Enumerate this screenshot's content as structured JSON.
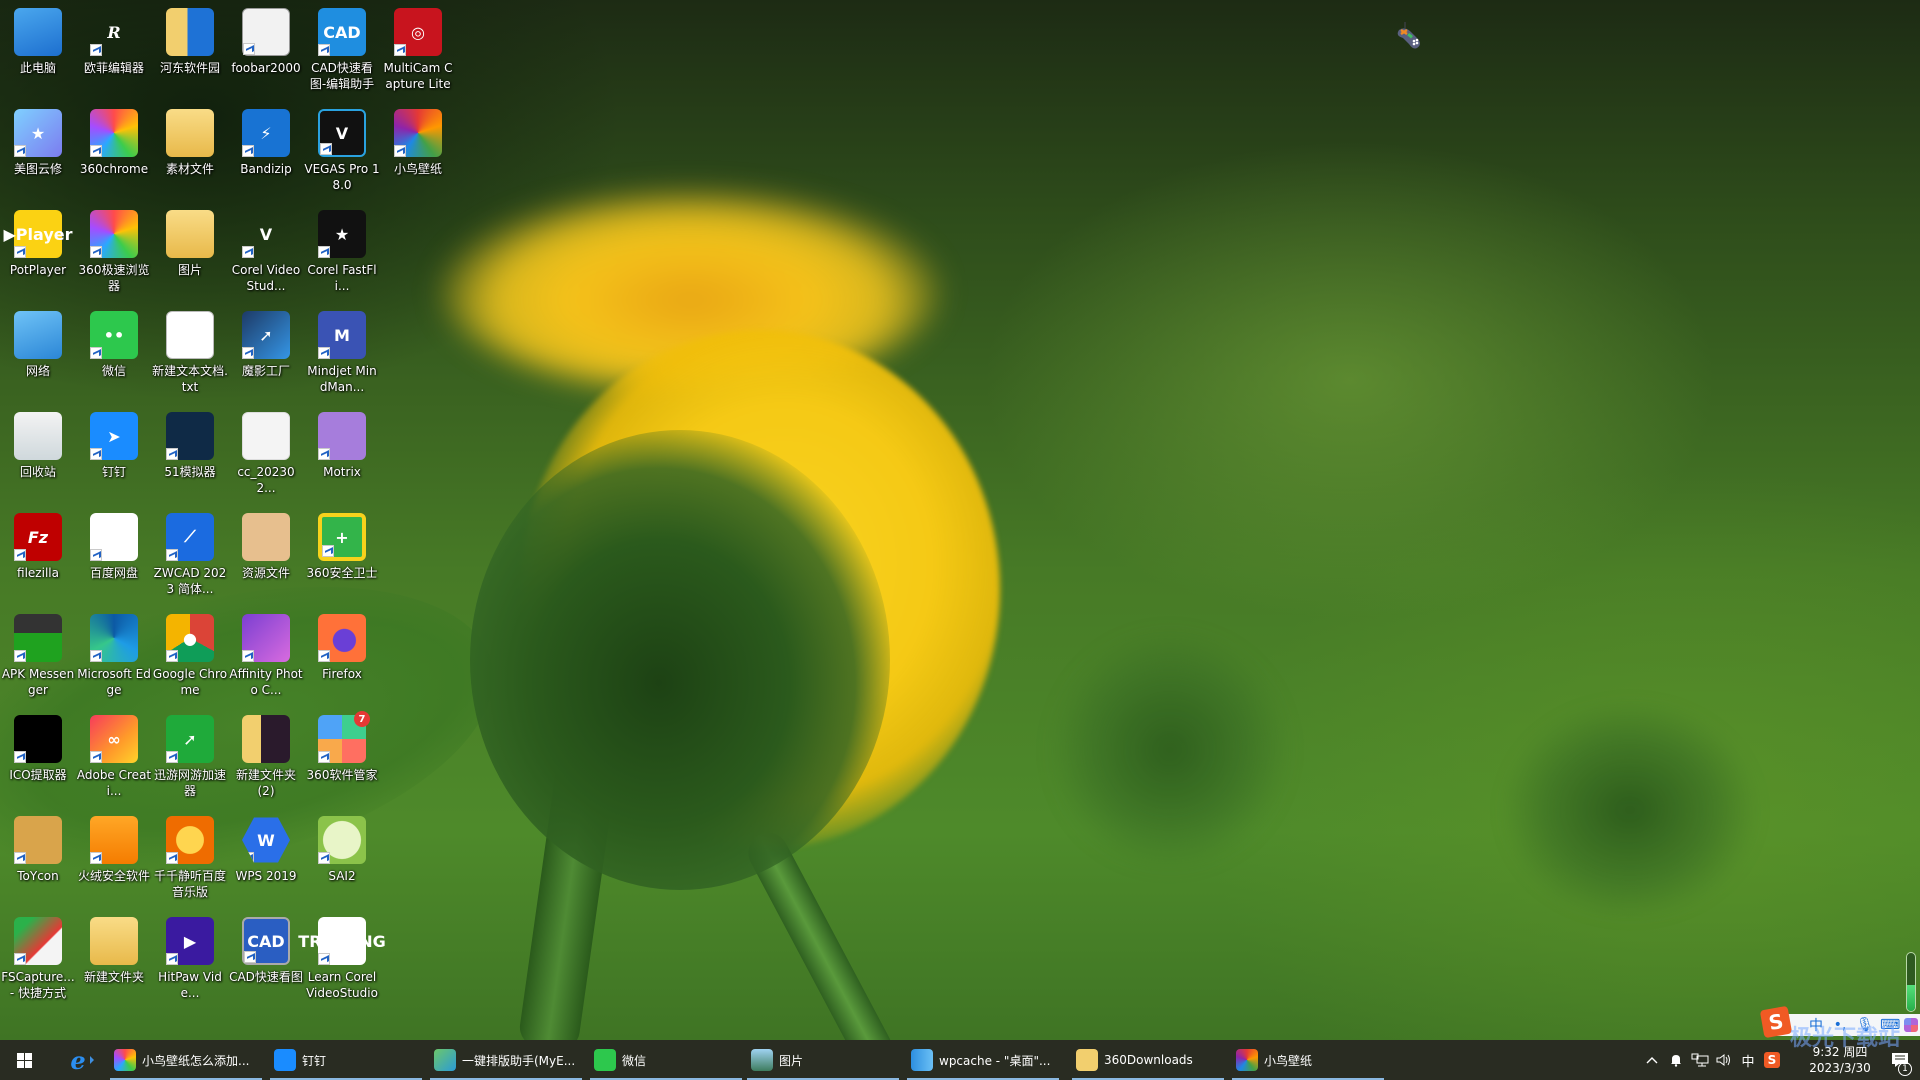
{
  "desktop": {
    "icons": [
      {
        "label": "此电脑",
        "icon": "computer-icon",
        "look": "g-pc",
        "glyph": "",
        "shortcut": false,
        "col": 0,
        "row": 0
      },
      {
        "label": "欧菲编辑器",
        "icon": "ofe-editor-icon",
        "look": "g-ofe",
        "glyph": "R",
        "shortcut": true,
        "col": 1,
        "row": 0
      },
      {
        "label": "河东软件园",
        "icon": "folder-icon",
        "look": "g-folder-blue",
        "glyph": "",
        "shortcut": false,
        "col": 2,
        "row": 0
      },
      {
        "label": "foobar2000",
        "icon": "foobar-icon",
        "look": "g-foobar",
        "glyph": "",
        "shortcut": true,
        "col": 3,
        "row": 0
      },
      {
        "label": "CAD快速看图-编辑助手",
        "icon": "cad-editor-icon",
        "look": "g-cad",
        "glyph": "CAD",
        "shortcut": true,
        "col": 4,
        "row": 0
      },
      {
        "label": "MultiCam Capture Lite",
        "icon": "multicam-icon",
        "look": "g-multicam",
        "glyph": "◎",
        "shortcut": true,
        "col": 5,
        "row": 0
      },
      {
        "label": "美图云修",
        "icon": "meitu-icon",
        "look": "g-meitu",
        "glyph": "★",
        "shortcut": true,
        "col": 0,
        "row": 1
      },
      {
        "label": "360chrome",
        "icon": "360chrome-icon",
        "look": "g-360chrome",
        "glyph": "",
        "shortcut": true,
        "col": 1,
        "row": 1
      },
      {
        "label": "素材文件",
        "icon": "folder-icon",
        "look": "g-folder",
        "glyph": "",
        "shortcut": false,
        "col": 2,
        "row": 1
      },
      {
        "label": "Bandizip",
        "icon": "bandizip-icon",
        "look": "g-bandizip",
        "glyph": "⚡",
        "shortcut": true,
        "col": 3,
        "row": 1
      },
      {
        "label": "VEGAS Pro 18.0",
        "icon": "vegas-icon",
        "look": "g-vegas",
        "glyph": "V",
        "shortcut": true,
        "col": 4,
        "row": 1
      },
      {
        "label": "小鸟壁纸",
        "icon": "xiaoniao-wallpaper-icon",
        "look": "g-xiaoniao",
        "glyph": "",
        "shortcut": true,
        "col": 5,
        "row": 1
      },
      {
        "label": "PotPlayer",
        "icon": "potplayer-icon",
        "look": "g-pot",
        "glyph": "▶Player",
        "shortcut": true,
        "col": 0,
        "row": 2
      },
      {
        "label": "360极速浏览器",
        "icon": "360-browser-icon",
        "look": "g-360chrome",
        "glyph": "",
        "shortcut": true,
        "col": 1,
        "row": 2
      },
      {
        "label": "图片",
        "icon": "folder-icon",
        "look": "g-folder",
        "glyph": "",
        "shortcut": false,
        "col": 2,
        "row": 2
      },
      {
        "label": "Corel VideoStud...",
        "icon": "corel-videostudio-icon",
        "look": "g-corel-vs",
        "glyph": "V",
        "shortcut": true,
        "col": 3,
        "row": 2
      },
      {
        "label": "Corel FastFli...",
        "icon": "corel-fastflick-icon",
        "look": "g-fastfli",
        "glyph": "★",
        "shortcut": true,
        "col": 4,
        "row": 2
      },
      {
        "label": "网络",
        "icon": "network-icon",
        "look": "g-network",
        "glyph": "",
        "shortcut": false,
        "col": 0,
        "row": 3
      },
      {
        "label": "微信",
        "icon": "wechat-icon",
        "look": "g-wechat",
        "glyph": "••",
        "shortcut": true,
        "col": 1,
        "row": 3
      },
      {
        "label": "新建文本文档.txt",
        "icon": "text-file-icon",
        "look": "g-txt",
        "glyph": "",
        "shortcut": false,
        "col": 2,
        "row": 3
      },
      {
        "label": "魔影工厂",
        "icon": "moying-factory-icon",
        "look": "g-moying",
        "glyph": "➚",
        "shortcut": true,
        "col": 3,
        "row": 3
      },
      {
        "label": "Mindjet MindMan...",
        "icon": "mindjet-icon",
        "look": "g-mindjet",
        "glyph": "M",
        "shortcut": true,
        "col": 4,
        "row": 3
      },
      {
        "label": "回收站",
        "icon": "recycle-bin-icon",
        "look": "g-recycle",
        "glyph": "",
        "shortcut": false,
        "col": 0,
        "row": 4
      },
      {
        "label": "钉钉",
        "icon": "dingtalk-icon",
        "look": "g-dingtalk",
        "glyph": "➤",
        "shortcut": true,
        "col": 1,
        "row": 4
      },
      {
        "label": "51模拟器",
        "icon": "51-emulator-icon",
        "look": "g-51",
        "glyph": "",
        "shortcut": true,
        "col": 2,
        "row": 4
      },
      {
        "label": "cc_202302...",
        "icon": "registry-file-icon",
        "look": "g-cc",
        "glyph": "",
        "shortcut": false,
        "col": 3,
        "row": 4
      },
      {
        "label": "Motrix",
        "icon": "motrix-icon",
        "look": "g-motrix",
        "glyph": "",
        "shortcut": true,
        "col": 4,
        "row": 4
      },
      {
        "label": "filezilla",
        "icon": "filezilla-icon",
        "look": "g-filezilla",
        "glyph": "Fz",
        "shortcut": true,
        "col": 0,
        "row": 5
      },
      {
        "label": "百度网盘",
        "icon": "baidu-netdisk-icon",
        "look": "g-baidupan",
        "glyph": "",
        "shortcut": true,
        "col": 1,
        "row": 5
      },
      {
        "label": "ZWCAD 2023 简体...",
        "icon": "zwcad-icon",
        "look": "g-zwcad",
        "glyph": "⟋",
        "shortcut": true,
        "col": 2,
        "row": 5
      },
      {
        "label": "资源文件",
        "icon": "resource-folder-icon",
        "look": "g-res",
        "glyph": "",
        "shortcut": false,
        "col": 3,
        "row": 5
      },
      {
        "label": "360安全卫士",
        "icon": "360-safe-icon",
        "look": "g-360safe",
        "glyph": "+",
        "shortcut": true,
        "col": 4,
        "row": 5
      },
      {
        "label": "APK Messenger",
        "icon": "apk-messenger-icon",
        "look": "g-apk",
        "glyph": "",
        "shortcut": true,
        "col": 0,
        "row": 6
      },
      {
        "label": "Microsoft Edge",
        "icon": "edge-icon",
        "look": "g-edge",
        "glyph": "",
        "shortcut": true,
        "col": 1,
        "row": 6
      },
      {
        "label": "Google Chrome",
        "icon": "chrome-icon",
        "look": "g-chrome",
        "glyph": "●",
        "shortcut": true,
        "col": 2,
        "row": 6
      },
      {
        "label": "Affinity Photo C...",
        "icon": "affinity-photo-icon",
        "look": "g-affinity",
        "glyph": "",
        "shortcut": true,
        "col": 3,
        "row": 6
      },
      {
        "label": "Firefox",
        "icon": "firefox-icon",
        "look": "g-firefox",
        "glyph": "",
        "shortcut": true,
        "col": 4,
        "row": 6
      },
      {
        "label": "ICO提取器",
        "icon": "ico-extractor-icon",
        "look": "g-ico",
        "glyph": "",
        "shortcut": true,
        "col": 0,
        "row": 7
      },
      {
        "label": "Adobe Creati...",
        "icon": "adobe-cc-icon",
        "look": "g-adobe",
        "glyph": "∞",
        "shortcut": true,
        "col": 1,
        "row": 7
      },
      {
        "label": "迅游网游加速器",
        "icon": "xunyou-icon",
        "look": "g-xunyou",
        "glyph": "➚",
        "shortcut": true,
        "col": 2,
        "row": 7
      },
      {
        "label": "新建文件夹 (2)",
        "icon": "folder-icon",
        "look": "g-newfolder2",
        "glyph": "",
        "shortcut": false,
        "col": 3,
        "row": 7
      },
      {
        "label": "360软件管家",
        "icon": "360-software-manager-icon",
        "look": "g-360soft",
        "glyph": "",
        "badge": "7",
        "shortcut": true,
        "col": 4,
        "row": 7
      },
      {
        "label": "ToYcon",
        "icon": "toycon-icon",
        "look": "g-toycon",
        "glyph": "",
        "shortcut": true,
        "col": 0,
        "row": 8
      },
      {
        "label": "火绒安全软件",
        "icon": "huorong-icon",
        "look": "g-huorong",
        "glyph": "",
        "shortcut": true,
        "col": 1,
        "row": 8
      },
      {
        "label": "千千静听百度音乐版",
        "icon": "ttplayer-icon",
        "look": "g-ttplayer",
        "glyph": "",
        "shortcut": true,
        "col": 2,
        "row": 8
      },
      {
        "label": "WPS 2019",
        "icon": "wps-icon",
        "look": "g-wps",
        "glyph": "W",
        "shortcut": true,
        "col": 3,
        "row": 8
      },
      {
        "label": "SAI2",
        "icon": "sai2-icon",
        "look": "g-sai",
        "glyph": "",
        "shortcut": true,
        "col": 4,
        "row": 8
      },
      {
        "label": "FSCapture... - 快捷方式",
        "icon": "fscapture-icon",
        "look": "g-fscapture",
        "glyph": "",
        "shortcut": true,
        "col": 0,
        "row": 9
      },
      {
        "label": "新建文件夹",
        "icon": "folder-icon",
        "look": "g-folder",
        "glyph": "",
        "shortcut": false,
        "col": 1,
        "row": 9
      },
      {
        "label": "HitPaw Vide...",
        "icon": "hitpaw-icon",
        "look": "g-hitpaw",
        "glyph": "▶",
        "shortcut": true,
        "col": 2,
        "row": 9
      },
      {
        "label": "CAD快速看图",
        "icon": "cad-viewer-icon",
        "look": "g-cadview",
        "glyph": "CAD",
        "shortcut": true,
        "col": 3,
        "row": 9
      },
      {
        "label": "Learn Corel VideoStudio",
        "icon": "learn-corel-icon",
        "look": "g-training",
        "glyph": "TRAINING",
        "shortcut": true,
        "col": 4,
        "row": 9
      }
    ]
  },
  "widgets": {
    "gamepad": "gamepad-icon",
    "volume_meter_level": 0.45
  },
  "ime_toolbar": {
    "logo": "S",
    "mode": "中",
    "punct": "•,",
    "mic": "🎙",
    "keyboard": "⌨"
  },
  "taskbar": {
    "start": "windows-start",
    "pinned": [
      {
        "name": "internet-explorer",
        "glyph": "e"
      }
    ],
    "buttons": [
      {
        "label": "小鸟壁纸怎么添加...",
        "icon": "360chrome-icon",
        "color": "conic-gradient(#ff4b4b,#ffc107,#3ccc4c,#2aa8ff,#a54cff,#ff4b4b)"
      },
      {
        "label": "钉钉",
        "icon": "dingtalk-icon",
        "color": "#1a8cff"
      },
      {
        "label": "一键排版助手(MyE...",
        "icon": "ofe-editor-icon",
        "color": "linear-gradient(135deg,#6cc76a,#2b9bd6)"
      },
      {
        "label": "微信",
        "icon": "wechat-icon",
        "color": "#2dc84d"
      },
      {
        "label": "图片",
        "icon": "photos-icon",
        "color": "linear-gradient(180deg,#9fd3f2,#3e7c5e)"
      },
      {
        "label": "wpcache - \"桌面\"...",
        "icon": "file-explorer-icon",
        "color": "linear-gradient(90deg,#2d8fe0,#6bc0f5)"
      },
      {
        "label": "360Downloads",
        "icon": "folder-icon",
        "color": "#f2cf6e"
      },
      {
        "label": "小鸟壁纸",
        "icon": "xiaoniao-wallpaper-icon",
        "color": "conic-gradient(#e53935,#ff9800,#43a047,#1e88e5,#8e24aa,#e53935)"
      }
    ],
    "tray": {
      "show_hidden": "^",
      "ime_indicator": "中",
      "time": "9:32 周四",
      "date": "2023/3/30",
      "notification_count": "1"
    }
  },
  "watermark": "极光下载站"
}
